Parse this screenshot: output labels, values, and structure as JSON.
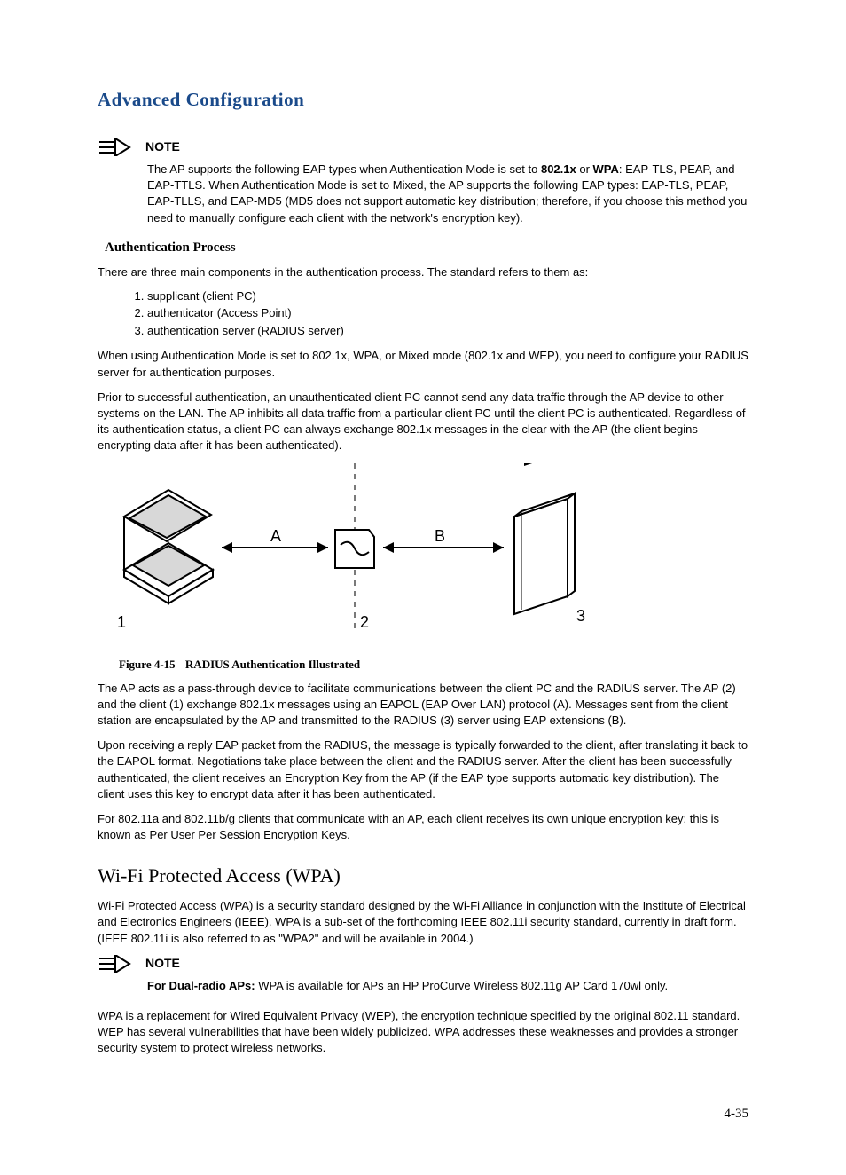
{
  "section_title": "Advanced Configuration",
  "note1": {
    "label": "NOTE",
    "body_pre": "The AP supports the following EAP types when Authentication Mode is set to ",
    "bold1": "802.1x",
    "mid": " or ",
    "bold2": "WPA",
    "body_post": ": EAP-TLS, PEAP, and EAP-TTLS. When Authentication Mode is set to Mixed, the AP supports the following EAP types: EAP-TLS, PEAP, EAP-TLLS, and EAP-MD5 (MD5 does not support automatic key distribution; therefore, if you choose this method you need to manually configure each client with the network's encryption key)."
  },
  "auth_process": {
    "heading": "Authentication Process",
    "intro": "There are three main components in the authentication process. The standard refers to them as:",
    "items": [
      "supplicant (client PC)",
      "authenticator (Access Point)",
      "authentication server (RADIUS server)"
    ],
    "p1": "When using Authentication Mode is set to 802.1x, WPA, or Mixed mode (802.1x and WEP), you need to configure your RADIUS server for authentication purposes.",
    "p2": "Prior to successful authentication, an unauthenticated client PC cannot send any data traffic through the AP device to other systems on the LAN. The AP inhibits all data traffic from a particular client PC until the client PC is authenticated. Regardless of its authentication status, a client PC can always exchange 802.1x messages in the clear with the AP (the client begins encrypting data after it has been authenticated)."
  },
  "figure": {
    "labels": {
      "A": "A",
      "B": "B",
      "n1": "1",
      "n2": "2",
      "n3": "3"
    },
    "caption_num": "Figure 4-15",
    "caption_title": "RADIUS Authentication Illustrated"
  },
  "after_fig": {
    "p1": "The AP acts as a pass-through device to facilitate communications between the client PC and the RADIUS server. The AP (2) and the client (1) exchange 802.1x messages using an EAPOL (EAP Over LAN) protocol (A). Messages sent from the client station are encapsulated by the AP and transmitted to the RADIUS (3) server using EAP extensions (B).",
    "p2": "Upon receiving a reply EAP packet from the RADIUS, the message is typically forwarded to the client, after translating it back to the EAPOL format. Negotiations take place between the client and the RADIUS server. After the client has been successfully authenticated, the client receives an Encryption Key from the AP (if the EAP type supports automatic key distribution). The client uses this key to encrypt data after it has been authenticated.",
    "p3": "For 802.11a and 802.11b/g clients that communicate with an AP, each client receives its own unique encryption key; this is known as Per User Per Session Encryption Keys."
  },
  "wpa": {
    "heading": "Wi-Fi Protected Access (WPA)",
    "p1": "Wi-Fi Protected Access (WPA) is a security standard designed by the Wi-Fi Alliance in conjunction with the Institute of Electrical and Electronics Engineers (IEEE). WPA is a sub-set of the forthcoming IEEE 802.11i security standard, currently in draft form. (IEEE 802.11i is also referred to as \"WPA2\" and will be available in 2004.)",
    "note": {
      "label": "NOTE",
      "bold": "For Dual-radio APs:",
      "rest": " WPA is available for APs an HP ProCurve Wireless 802.11g AP Card 170wl only."
    },
    "p2": "WPA is a replacement for Wired Equivalent Privacy (WEP), the encryption technique specified by the original 802.11 standard. WEP has several vulnerabilities that have been widely publicized. WPA addresses these weaknesses and provides a stronger security system to protect wireless networks."
  },
  "page_number": "4-35"
}
